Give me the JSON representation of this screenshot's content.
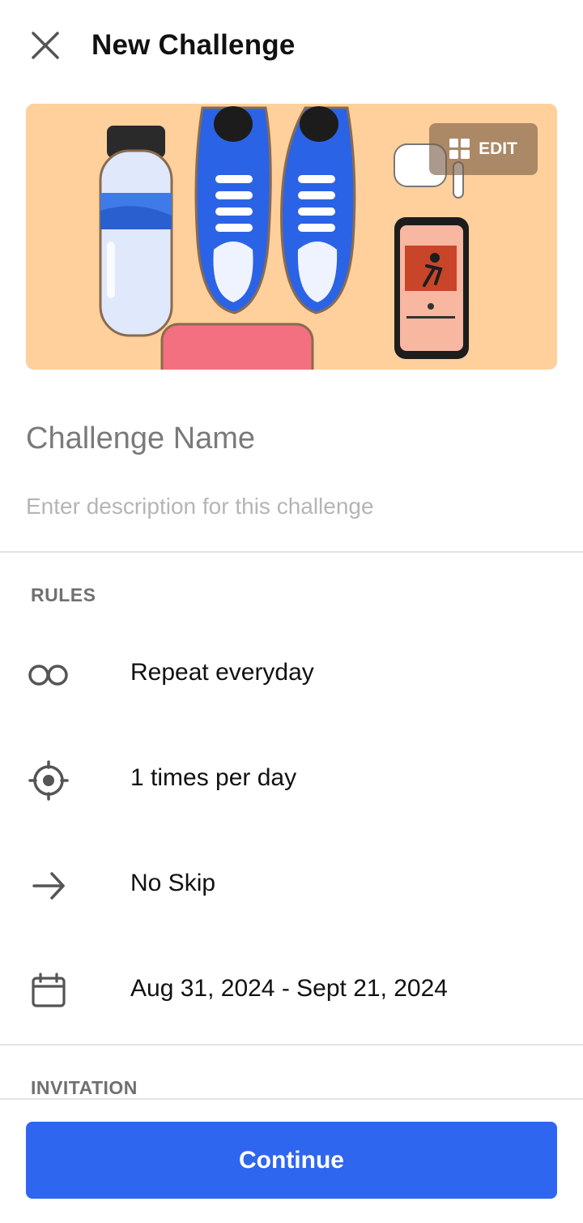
{
  "header": {
    "title": "New Challenge",
    "close_icon": "close-icon"
  },
  "cover": {
    "edit_label": "EDIT",
    "edit_icon": "grid-icon",
    "background": "#ffd09c"
  },
  "form": {
    "name_placeholder": "Challenge Name",
    "description_placeholder": "Enter description for this challenge"
  },
  "rules": {
    "section_label": "RULES",
    "items": [
      {
        "icon": "infinity-icon",
        "label": "Repeat everyday"
      },
      {
        "icon": "target-icon",
        "label": "1 times per day"
      },
      {
        "icon": "arrow-right-icon",
        "label": "No Skip"
      },
      {
        "icon": "calendar-icon",
        "label": "Aug 31, 2024 - Sept 21, 2024"
      }
    ]
  },
  "invitation": {
    "section_label": "INVITATION"
  },
  "footer": {
    "continue_label": "Continue",
    "accent": "#2f66f0"
  }
}
